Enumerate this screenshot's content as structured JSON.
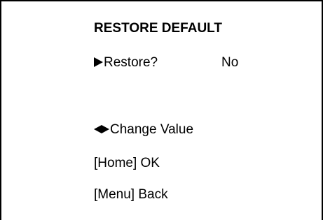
{
  "menu": {
    "title": "RESTORE DEFAULT",
    "restore_label": "Restore?",
    "restore_value": "No",
    "change_value_label": "Change Value",
    "home_hint": "[Home] OK",
    "menu_hint": "[Menu] Back"
  },
  "icons": {
    "selection_cursor": "right-triangle-icon",
    "change_value": "left-right-arrows-icon"
  },
  "colors": {
    "background": "#ffffff",
    "foreground": "#000000"
  }
}
